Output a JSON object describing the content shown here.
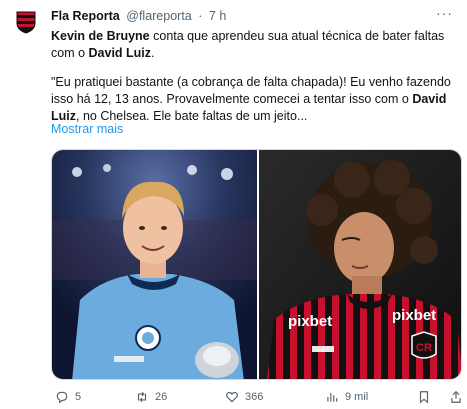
{
  "tweet": {
    "author_name": "Fla Reporta",
    "handle": "@flareporta",
    "separator": "·",
    "time": "7 h",
    "more_icon": "more-dots-icon",
    "p1_bold_1": "Kevin de Bruyne",
    "p1_text_1": " conta que aprendeu sua atual técnica de bater faltas com o ",
    "p1_bold_2": "David Luiz",
    "p1_text_2": ".",
    "p2_text_1": "\"Eu pratiquei bastante (a cobrança de falta chapada)! Eu venho fazendo isso há 12, 13 anos. Provavelmente comecei a tentar isso com o ",
    "p2_bold": "David Luiz",
    "p2_text_2": ", no Chelsea. Ele bate faltas de um jeito...",
    "show_more": "Mostrar mais"
  },
  "media": {
    "left_photo": "Kevin de Bruyne in Manchester City jersey",
    "right_photo": "David Luiz in Flamengo jersey",
    "sponsor_1": "pixbet",
    "sponsor_2": "pixbet",
    "colors": {
      "city_blue": "#6cabdd",
      "fla_red": "#c8102e",
      "fla_black": "#111111"
    }
  },
  "actions": {
    "reply_count": "5",
    "retweet_count": "26",
    "like_count": "366",
    "views_count": "9 mil"
  }
}
